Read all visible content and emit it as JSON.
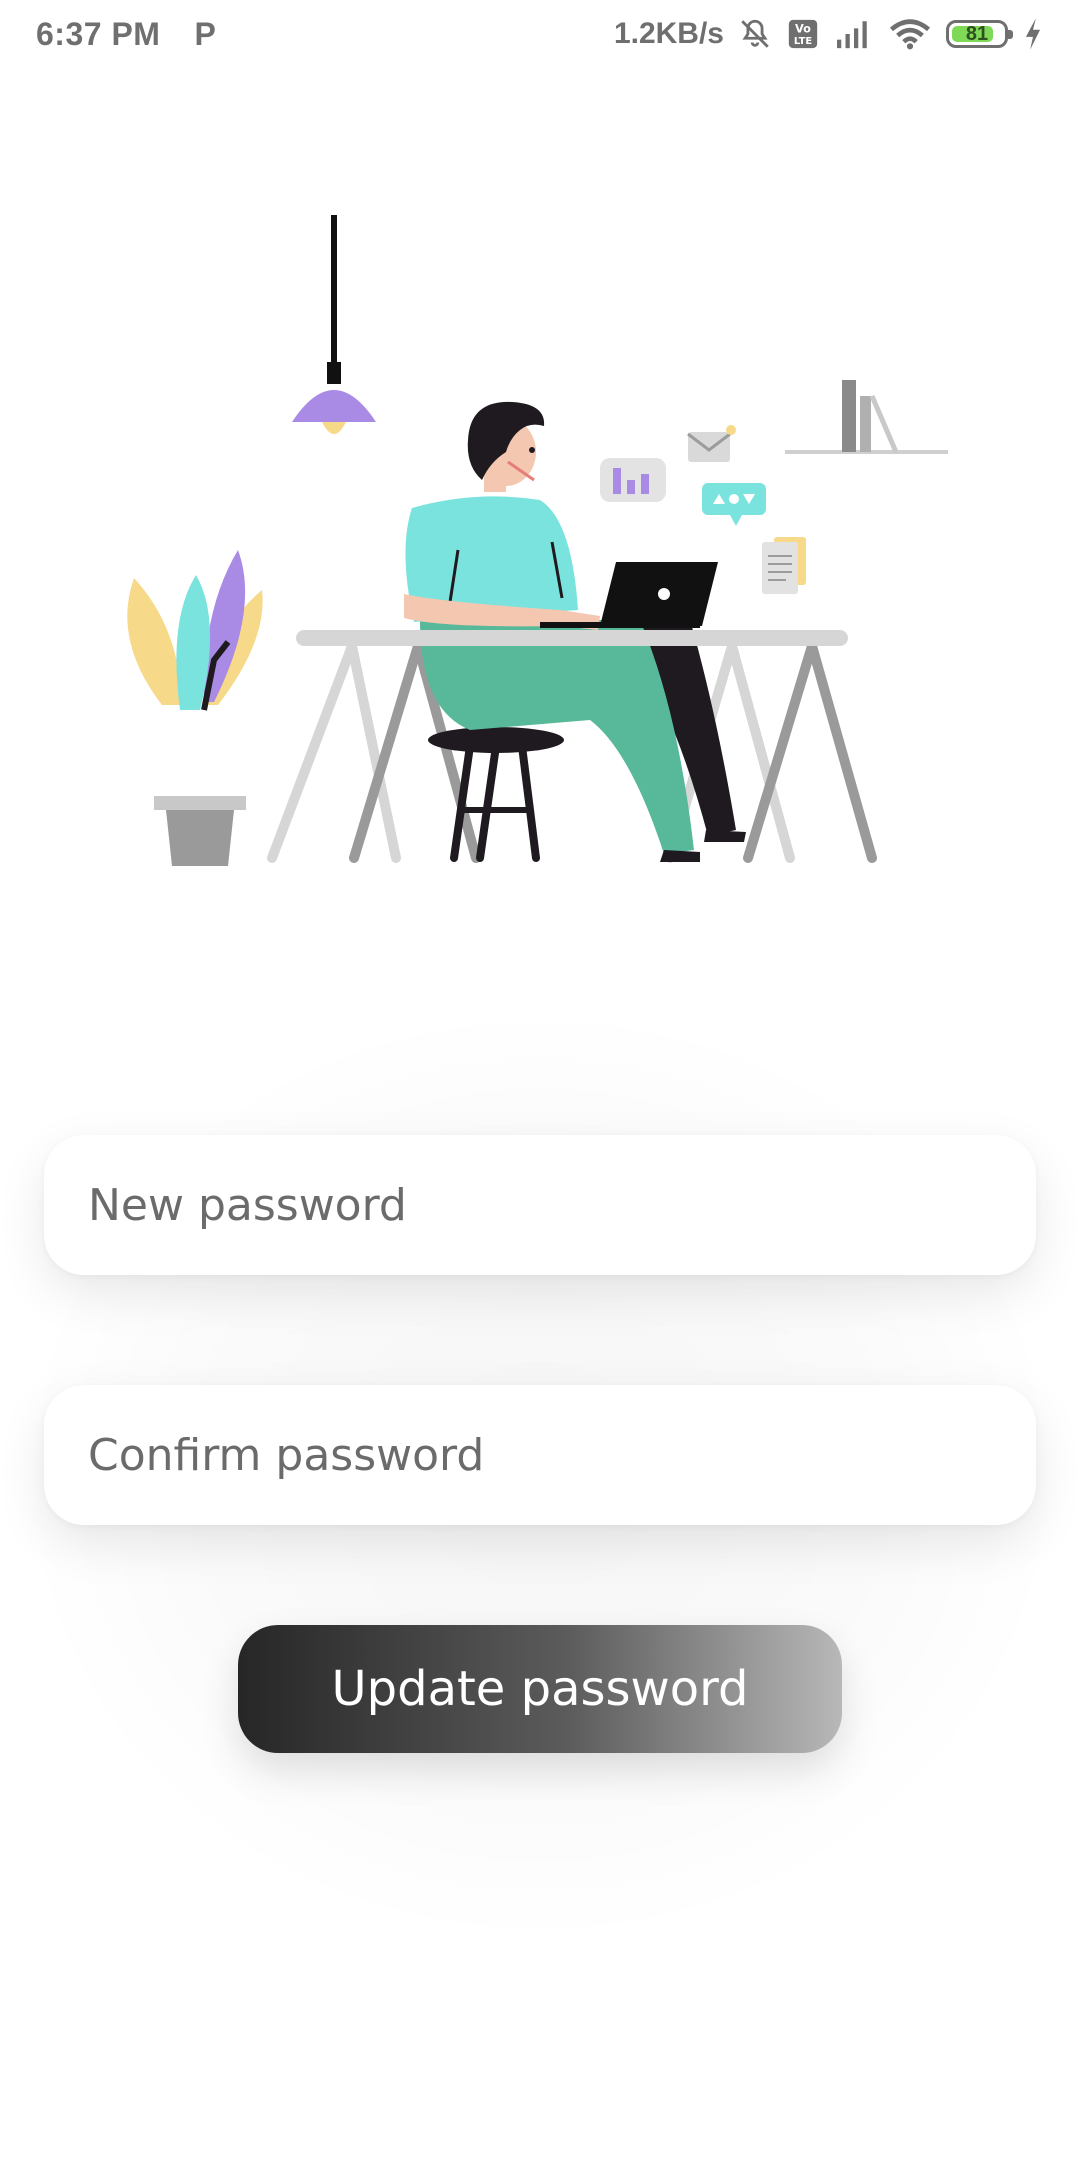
{
  "status_bar": {
    "time": "6:37 PM",
    "app_icon": "P",
    "net_speed": "1.2KB/s",
    "battery_level": "81",
    "battery_fill_fraction": 0.81,
    "icons": [
      "mute-icon",
      "volte-icon",
      "signal-icon",
      "wifi-icon",
      "battery-icon",
      "charging-icon"
    ]
  },
  "form": {
    "new_password_placeholder": "New password",
    "confirm_password_placeholder": "Confirm password",
    "submit_label": "Update password"
  },
  "colors": {
    "accent_teal": "#7be3de",
    "accent_purple": "#a98be6",
    "accent_green": "#58b89a",
    "accent_yellow": "#f7d98a",
    "button_dark": "#262626",
    "button_light": "#b8b8b8"
  }
}
